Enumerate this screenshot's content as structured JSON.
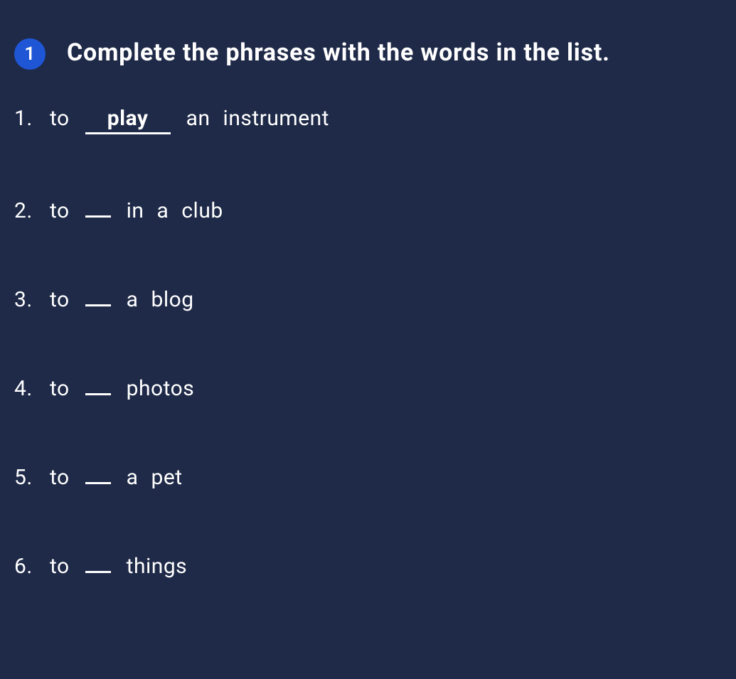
{
  "exercise": {
    "number": "1",
    "instruction": "Complete the phrases with the words in the list."
  },
  "items": [
    {
      "num": "1.",
      "pre": [
        "to"
      ],
      "blank": "play",
      "post": [
        "an",
        "instrument"
      ]
    },
    {
      "num": "2.",
      "pre": [
        "to"
      ],
      "blank": "",
      "post": [
        "in",
        "a",
        "club"
      ]
    },
    {
      "num": "3.",
      "pre": [
        "to"
      ],
      "blank": "",
      "post": [
        "a",
        "blog"
      ]
    },
    {
      "num": "4.",
      "pre": [
        "to"
      ],
      "blank": "",
      "post": [
        "photos"
      ]
    },
    {
      "num": "5.",
      "pre": [
        "to"
      ],
      "blank": "",
      "post": [
        "a",
        "pet"
      ]
    },
    {
      "num": "6.",
      "pre": [
        "to"
      ],
      "blank": "",
      "post": [
        "things"
      ]
    }
  ]
}
